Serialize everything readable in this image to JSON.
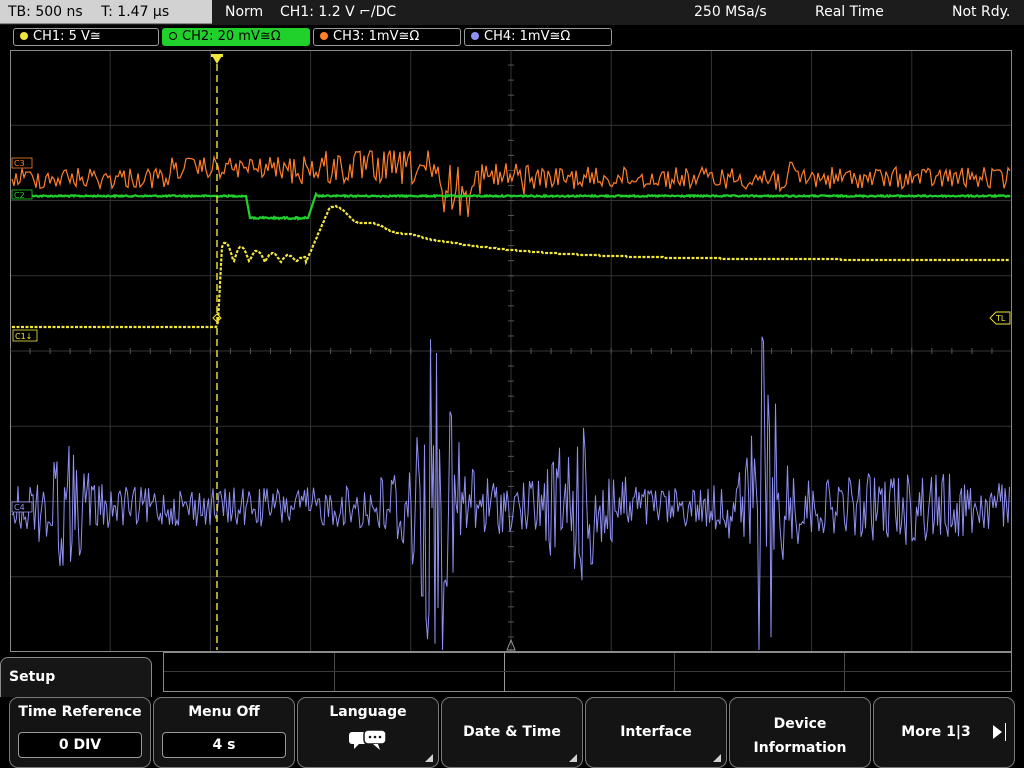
{
  "status": {
    "timebase": "TB: 500 ns",
    "trigger_time": "T: 1.47 µs",
    "mode": "Norm",
    "trigger": "CH1: 1.2 V ⌐/DC",
    "sample_rate": "250 MSa/s",
    "acq_mode": "Real Time",
    "state": "Not Rdy."
  },
  "channels": [
    {
      "label": "CH1: 5 V≅",
      "color": "#f3e63a",
      "active": false
    },
    {
      "label": "CH2: 20 mV≅Ω",
      "color": "#1fd12a",
      "active": true
    },
    {
      "label": "CH3: 1mV≅Ω",
      "color": "#ff7f2a",
      "active": false
    },
    {
      "label": "CH4: 1mV≅Ω",
      "color": "#8f8ff0",
      "active": false
    }
  ],
  "markers": {
    "ch1": "C1↓",
    "ch2": "C2",
    "ch3": "C3",
    "ch4": "C4",
    "trigger_level": "TL"
  },
  "menu": {
    "title": "Setup",
    "time_reference": {
      "title": "Time Reference",
      "value": "0 DIV"
    },
    "menu_off": {
      "title": "Menu Off",
      "value": "4 s"
    },
    "language": {
      "title": "Language",
      "icon": "speech-bubbles-icon"
    },
    "date_time": "Date & Time",
    "interface": "Interface",
    "device_information": {
      "line1": "Device",
      "line2": "Information"
    },
    "more": "More 1|3"
  }
}
